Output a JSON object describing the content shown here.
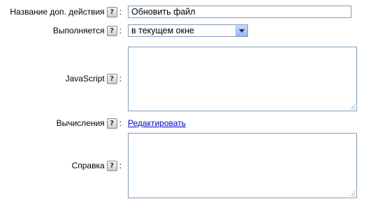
{
  "form": {
    "name": {
      "label": "Название доп. действия",
      "help": "?",
      "colon": ":",
      "value": "Обновить файл"
    },
    "executes": {
      "label": "Выполняется",
      "help": "?",
      "colon": ":",
      "selected": "в текущем окне"
    },
    "javascript": {
      "label": "JavaScript",
      "help": "?",
      "colon": ":",
      "value": ""
    },
    "calculations": {
      "label": "Вычисления",
      "help": "?",
      "colon": ":",
      "link": "Редактировать"
    },
    "help_text": {
      "label": "Справка",
      "help": "?",
      "colon": ":",
      "value": ""
    }
  },
  "colors": {
    "field_border": "#7f9db9",
    "link": "#0000cc",
    "select_button": "#9ab7ec"
  },
  "icons": {
    "help": "question-mark-icon",
    "dropdown": "chevron-down-icon",
    "resize": "resize-grip-icon"
  }
}
